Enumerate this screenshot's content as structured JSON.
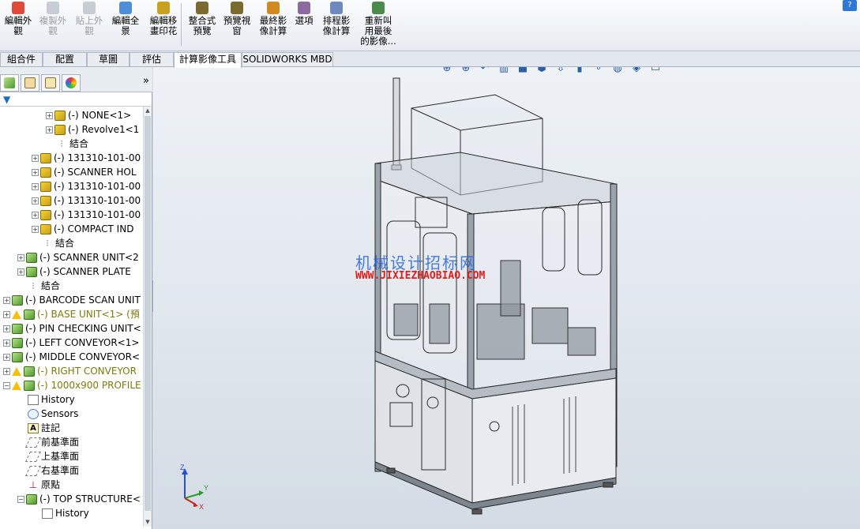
{
  "ribbon": {
    "buttons": [
      {
        "label": "編輯外\n觀",
        "icon": "appearance-icon",
        "disabled": false
      },
      {
        "label": "複製外\n觀",
        "icon": "copy-appearance-icon",
        "disabled": true
      },
      {
        "label": "貼上外\n觀",
        "icon": "paste-appearance-icon",
        "disabled": true
      },
      {
        "label": "編輯全\n景",
        "icon": "scene-icon",
        "disabled": false
      },
      {
        "label": "編輯移\n畫印花",
        "icon": "decal-icon",
        "disabled": false
      },
      {
        "label": "整合式\n預覽",
        "icon": "integrated-preview-icon",
        "disabled": false
      },
      {
        "label": "預覽視\n窗",
        "icon": "preview-window-icon",
        "disabled": false
      },
      {
        "label": "最終影\n像計算",
        "icon": "final-render-icon",
        "disabled": false
      },
      {
        "label": "選項",
        "icon": "options-icon",
        "disabled": false
      },
      {
        "label": "排程影\n像計算",
        "icon": "schedule-render-icon",
        "disabled": false
      },
      {
        "label": "重新叫\n用最後\n的影像...",
        "icon": "recall-last-image-icon",
        "disabled": false
      }
    ],
    "help": "?"
  },
  "tabs": [
    "組合件",
    "配置",
    "草圖",
    "評估",
    "計算影像工具",
    "SOLIDWORKS MBD"
  ],
  "active_tab": "計算影像工具",
  "pane": {
    "more": "»",
    "filter": "▼"
  },
  "tree": [
    {
      "text": "(-) NONE<1>",
      "type": "asm",
      "indent": 3,
      "expander": "+"
    },
    {
      "text": "(-) Revolve1<1",
      "type": "asm",
      "indent": 3,
      "expander": "+"
    },
    {
      "text": "結合",
      "type": "mate",
      "indent": 3,
      "expander": ""
    },
    {
      "text": "(-) 131310-101-00",
      "type": "asm",
      "indent": 2,
      "expander": "+"
    },
    {
      "text": "(-) SCANNER HOL",
      "type": "asm",
      "indent": 2,
      "expander": "+"
    },
    {
      "text": "(-) 131310-101-00",
      "type": "asm",
      "indent": 2,
      "expander": "+"
    },
    {
      "text": "(-) 131310-101-00",
      "type": "asm",
      "indent": 2,
      "expander": "+"
    },
    {
      "text": "(-) 131310-101-00",
      "type": "asm",
      "indent": 2,
      "expander": "+"
    },
    {
      "text": "(-) COMPACT IND",
      "type": "asm",
      "indent": 2,
      "expander": "+"
    },
    {
      "text": "結合",
      "type": "mate",
      "indent": 2,
      "expander": ""
    },
    {
      "text": "(-) SCANNER UNIT<2",
      "type": "asmg",
      "indent": 1,
      "expander": "+"
    },
    {
      "text": "(-) SCANNER PLATE",
      "type": "asmg",
      "indent": 1,
      "expander": "+"
    },
    {
      "text": "結合",
      "type": "mate",
      "indent": 1,
      "expander": ""
    },
    {
      "text": "(-) BARCODE SCAN UNIT",
      "type": "asmg",
      "indent": 0,
      "expander": "+"
    },
    {
      "text": "(-) BASE UNIT<1> (預",
      "type": "asmg",
      "indent": 0,
      "expander": "+",
      "warn": true
    },
    {
      "text": "(-) PIN CHECKING UNIT<",
      "type": "asmg",
      "indent": 0,
      "expander": "+"
    },
    {
      "text": "(-) LEFT CONVEYOR<1>",
      "type": "asmg",
      "indent": 0,
      "expander": "+"
    },
    {
      "text": "(-) MIDDLE CONVEYOR<",
      "type": "asmg",
      "indent": 0,
      "expander": "+"
    },
    {
      "text": "(-) RIGHT CONVEYOR",
      "type": "asmg",
      "indent": 0,
      "expander": "+",
      "warn": true
    },
    {
      "text": "(-) 1000x900 PROFILE",
      "type": "asmg",
      "indent": 0,
      "expander": "−",
      "warn": true
    },
    {
      "text": "History",
      "type": "hist",
      "indent": 1,
      "expander": ""
    },
    {
      "text": "Sensors",
      "type": "sens",
      "indent": 1,
      "expander": ""
    },
    {
      "text": "註記",
      "type": "note",
      "indent": 1,
      "expander": ""
    },
    {
      "text": "前基準面",
      "type": "plane",
      "indent": 1,
      "expander": ""
    },
    {
      "text": "上基準面",
      "type": "plane",
      "indent": 1,
      "expander": ""
    },
    {
      "text": "右基準面",
      "type": "plane",
      "indent": 1,
      "expander": ""
    },
    {
      "text": "原點",
      "type": "orig",
      "indent": 1,
      "expander": ""
    },
    {
      "text": "(-) TOP STRUCTURE<",
      "type": "asmg",
      "indent": 1,
      "expander": "−"
    },
    {
      "text": "History",
      "type": "hist",
      "indent": 2,
      "expander": ""
    }
  ],
  "watermark": {
    "line1": "机械设计招标网",
    "line2": "WWW.JIXIEZHAOBIAO.COM"
  },
  "triad": {
    "x": "X",
    "y": "Y",
    "z": "Z"
  },
  "colors": {
    "accent": "#2d78d4",
    "warning": "#f4c20d",
    "watermark_blue": "#2b66d8",
    "watermark_red": "#e21d1d"
  }
}
